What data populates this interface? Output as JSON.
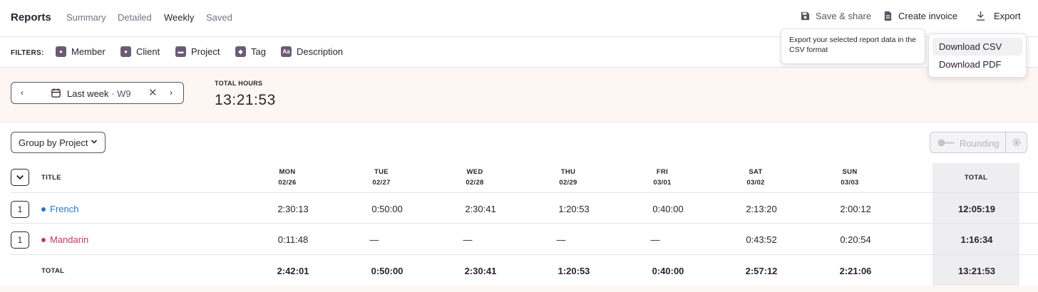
{
  "header": {
    "title": "Reports",
    "tabs": [
      {
        "label": "Summary",
        "active": false
      },
      {
        "label": "Detailed",
        "active": false
      },
      {
        "label": "Weekly",
        "active": true
      },
      {
        "label": "Saved",
        "active": false
      }
    ],
    "actions": {
      "save_share": "Save & share",
      "create_invoice": "Create invoice",
      "export": "Export"
    }
  },
  "export_menu": {
    "tooltip": "Export your selected report data in the CSV format",
    "items": [
      "Download CSV",
      "Download PDF"
    ]
  },
  "filters": {
    "label": "FILTERS:",
    "items": [
      {
        "label": "Member",
        "icon": "member-icon"
      },
      {
        "label": "Client",
        "icon": "client-icon"
      },
      {
        "label": "Project",
        "icon": "project-icon"
      },
      {
        "label": "Tag",
        "icon": "tag-icon"
      },
      {
        "label": "Description",
        "icon": "description-icon"
      }
    ]
  },
  "date_range": {
    "label": "Last week",
    "week": "W9",
    "separator": "·"
  },
  "summary": {
    "total_label": "TOTAL HOURS",
    "total_value": "13:21:53"
  },
  "controls": {
    "group_by": "Group by Project",
    "rounding": "Rounding"
  },
  "table": {
    "title_header": "TITLE",
    "total_header": "TOTAL",
    "days": [
      {
        "name": "MON",
        "date": "02/26"
      },
      {
        "name": "TUE",
        "date": "02/27"
      },
      {
        "name": "WED",
        "date": "02/28"
      },
      {
        "name": "THU",
        "date": "02/29"
      },
      {
        "name": "FRI",
        "date": "03/01"
      },
      {
        "name": "SAT",
        "date": "03/02"
      },
      {
        "name": "SUN",
        "date": "03/03"
      }
    ],
    "rows": [
      {
        "count": "1",
        "project": "French",
        "color": "#1f78c8",
        "values": [
          "2:30:13",
          "0:50:00",
          "2:30:41",
          "1:20:53",
          "0:40:00",
          "2:13:20",
          "2:00:12"
        ],
        "total": "12:05:19"
      },
      {
        "count": "1",
        "project": "Mandarin",
        "color": "#c9336f",
        "values": [
          "0:11:48",
          "—",
          "—",
          "—",
          "—",
          "0:43:52",
          "0:20:54"
        ],
        "total": "1:16:34"
      }
    ],
    "totals": {
      "label": "TOTAL",
      "values": [
        "2:42:01",
        "0:50:00",
        "2:30:41",
        "1:20:53",
        "0:40:00",
        "2:57:12",
        "2:21:06"
      ],
      "total": "13:21:53"
    }
  },
  "colors": {
    "accent": "#6b5b75",
    "band": "#fdf6f3",
    "total_column": "#eeedef"
  }
}
